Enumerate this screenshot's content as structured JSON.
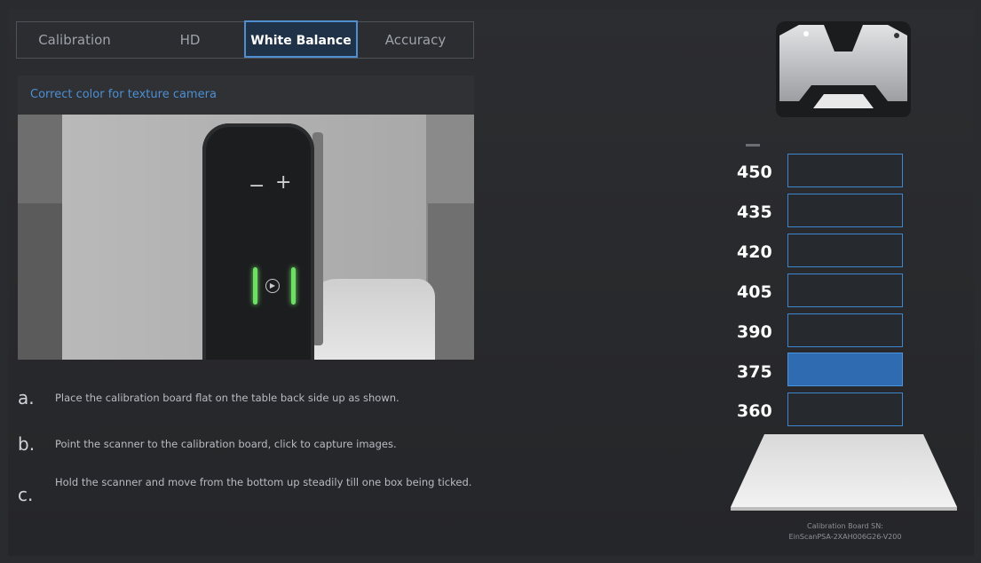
{
  "tabs": [
    {
      "label": "Calibration",
      "active": false
    },
    {
      "label": "HD",
      "active": false
    },
    {
      "label": "White Balance",
      "active": true
    },
    {
      "label": "Accuracy",
      "active": false
    }
  ],
  "panel": {
    "subtitle": "Correct color for texture camera",
    "camera_minus": "−",
    "camera_plus": "+"
  },
  "steps": [
    {
      "letter": "a.",
      "text": "Place the calibration board flat on the table back side up as shown."
    },
    {
      "letter": "b.",
      "text": "Point the scanner to the calibration board, click  to capture images."
    },
    {
      "letter": "c.",
      "text": "Hold the scanner and move from the bottom up steadily till one box being ticked."
    }
  ],
  "levels": [
    {
      "label": "450",
      "active": false
    },
    {
      "label": "435",
      "active": false
    },
    {
      "label": "420",
      "active": false
    },
    {
      "label": "405",
      "active": false
    },
    {
      "label": "390",
      "active": false
    },
    {
      "label": "375",
      "active": true
    },
    {
      "label": "360",
      "active": false
    }
  ],
  "board": {
    "sn_label": "Calibration Board SN:",
    "sn_value": "EinScanPSA-2XAH006G26-V200"
  },
  "colors": {
    "accent": "#4f8fcf",
    "active_level": "#2f6bb0",
    "led": "#6ddf62"
  }
}
